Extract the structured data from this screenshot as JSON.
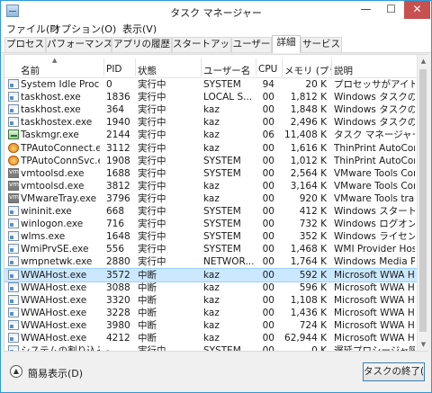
{
  "window": {
    "title": "タスク マネージャー",
    "minimize": "—",
    "maximize": "☐",
    "close": "✕"
  },
  "menu": [
    "ファイル(F)",
    "オプション(O)",
    "表示(V)"
  ],
  "tabs": [
    "プロセス",
    "パフォーマンス",
    "アプリの履歴",
    "スタートアップ",
    "ユーザー",
    "詳細",
    "サービス"
  ],
  "active_tab": "詳細",
  "columns": [
    "名前",
    "PID",
    "状態",
    "ユーザー名",
    "CPU",
    "メモリ (プラ...",
    "説明"
  ],
  "rows": [
    {
      "icon": "window-app-icon",
      "name": "System Idle Process",
      "pid": "0",
      "status": "実行中",
      "user": "SYSTEM",
      "cpu": "94",
      "memory": "20 K",
      "desc": "プロセッサがアイドル状..."
    },
    {
      "icon": "window-app-icon",
      "name": "taskhost.exe",
      "pid": "1836",
      "status": "実行中",
      "user": "LOCAL S...",
      "cpu": "00",
      "memory": "1,812 K",
      "desc": "Windows タスクのホ..."
    },
    {
      "icon": "window-app-icon",
      "name": "taskhost.exe",
      "pid": "364",
      "status": "実行中",
      "user": "kaz",
      "cpu": "00",
      "memory": "1,848 K",
      "desc": "Windows タスクのホ..."
    },
    {
      "icon": "window-app-icon",
      "name": "taskhostex.exe",
      "pid": "1940",
      "status": "実行中",
      "user": "kaz",
      "cpu": "00",
      "memory": "2,496 K",
      "desc": "Windows タスクのホ..."
    },
    {
      "icon": "task-manager-icon",
      "name": "Taskmgr.exe",
      "pid": "2144",
      "status": "実行中",
      "user": "kaz",
      "cpu": "06",
      "memory": "11,408 K",
      "desc": "タスク マネージャー"
    },
    {
      "icon": "thinprint-icon",
      "name": "TPAutoConnect.exe",
      "pid": "3112",
      "status": "実行中",
      "user": "kaz",
      "cpu": "00",
      "memory": "1,616 K",
      "desc": "ThinPrint AutoCon..."
    },
    {
      "icon": "thinprint-icon",
      "name": "TPAutoConnSvc.exe",
      "pid": "1908",
      "status": "実行中",
      "user": "SYSTEM",
      "cpu": "00",
      "memory": "1,012 K",
      "desc": "ThinPrint AutoCon..."
    },
    {
      "icon": "vmware-icon",
      "name": "vmtoolsd.exe",
      "pid": "1688",
      "status": "実行中",
      "user": "SYSTEM",
      "cpu": "00",
      "memory": "2,564 K",
      "desc": "VMware Tools Cor..."
    },
    {
      "icon": "vmware-icon",
      "name": "vmtoolsd.exe",
      "pid": "3812",
      "status": "実行中",
      "user": "kaz",
      "cpu": "00",
      "memory": "3,164 K",
      "desc": "VMware Tools Cor..."
    },
    {
      "icon": "vmware-icon",
      "name": "VMwareTray.exe",
      "pid": "3796",
      "status": "実行中",
      "user": "kaz",
      "cpu": "00",
      "memory": "920 K",
      "desc": "VMware Tools tra..."
    },
    {
      "icon": "window-app-icon",
      "name": "wininit.exe",
      "pid": "668",
      "status": "実行中",
      "user": "SYSTEM",
      "cpu": "00",
      "memory": "412 K",
      "desc": "Windows スタートア..."
    },
    {
      "icon": "window-app-icon",
      "name": "winlogon.exe",
      "pid": "716",
      "status": "実行中",
      "user": "SYSTEM",
      "cpu": "00",
      "memory": "732 K",
      "desc": "Windows ログオン ア..."
    },
    {
      "icon": "window-app-icon",
      "name": "wlms.exe",
      "pid": "1648",
      "status": "実行中",
      "user": "SYSTEM",
      "cpu": "00",
      "memory": "352 K",
      "desc": "Windows ライセンス..."
    },
    {
      "icon": "window-app-icon",
      "name": "WmiPrvSE.exe",
      "pid": "556",
      "status": "実行中",
      "user": "SYSTEM",
      "cpu": "00",
      "memory": "1,468 K",
      "desc": "WMI Provider Host"
    },
    {
      "icon": "window-app-icon",
      "name": "wmpnetwk.exe",
      "pid": "2880",
      "status": "実行中",
      "user": "NETWOR...",
      "cpu": "00",
      "memory": "1,764 K",
      "desc": "Windows Media Pl..."
    },
    {
      "icon": "window-app-icon",
      "name": "WWAHost.exe",
      "pid": "3572",
      "status": "中断",
      "user": "kaz",
      "cpu": "00",
      "memory": "592 K",
      "desc": "Microsoft WWA H..."
    },
    {
      "icon": "window-app-icon",
      "name": "WWAHost.exe",
      "pid": "3088",
      "status": "中断",
      "user": "kaz",
      "cpu": "00",
      "memory": "596 K",
      "desc": "Microsoft WWA H..."
    },
    {
      "icon": "window-app-icon",
      "name": "WWAHost.exe",
      "pid": "3320",
      "status": "中断",
      "user": "kaz",
      "cpu": "00",
      "memory": "1,108 K",
      "desc": "Microsoft WWA H..."
    },
    {
      "icon": "window-app-icon",
      "name": "WWAHost.exe",
      "pid": "3228",
      "status": "中断",
      "user": "kaz",
      "cpu": "00",
      "memory": "1,436 K",
      "desc": "Microsoft WWA H..."
    },
    {
      "icon": "window-app-icon",
      "name": "WWAHost.exe",
      "pid": "3980",
      "status": "中断",
      "user": "kaz",
      "cpu": "00",
      "memory": "724 K",
      "desc": "Microsoft WWA H..."
    },
    {
      "icon": "window-app-icon",
      "name": "WWAHost.exe",
      "pid": "4212",
      "status": "中断",
      "user": "kaz",
      "cpu": "00",
      "memory": "62,944 K",
      "desc": "Microsoft WWA H..."
    },
    {
      "icon": "window-app-icon",
      "name": "システムの割り込み",
      "pid": "-",
      "status": "実行中",
      "user": "SYSTEM",
      "cpu": "00",
      "memory": "0 K",
      "desc": "遅延プロシージャ呼び..."
    }
  ],
  "selected_row": 15,
  "footer": {
    "fewer_details": "簡易表示(D)",
    "end_task": "タスクの終了(E)"
  },
  "colors": {
    "accent": "#2c9bd6",
    "selected_row": "#cce8ff",
    "close_button": "#c75050"
  }
}
